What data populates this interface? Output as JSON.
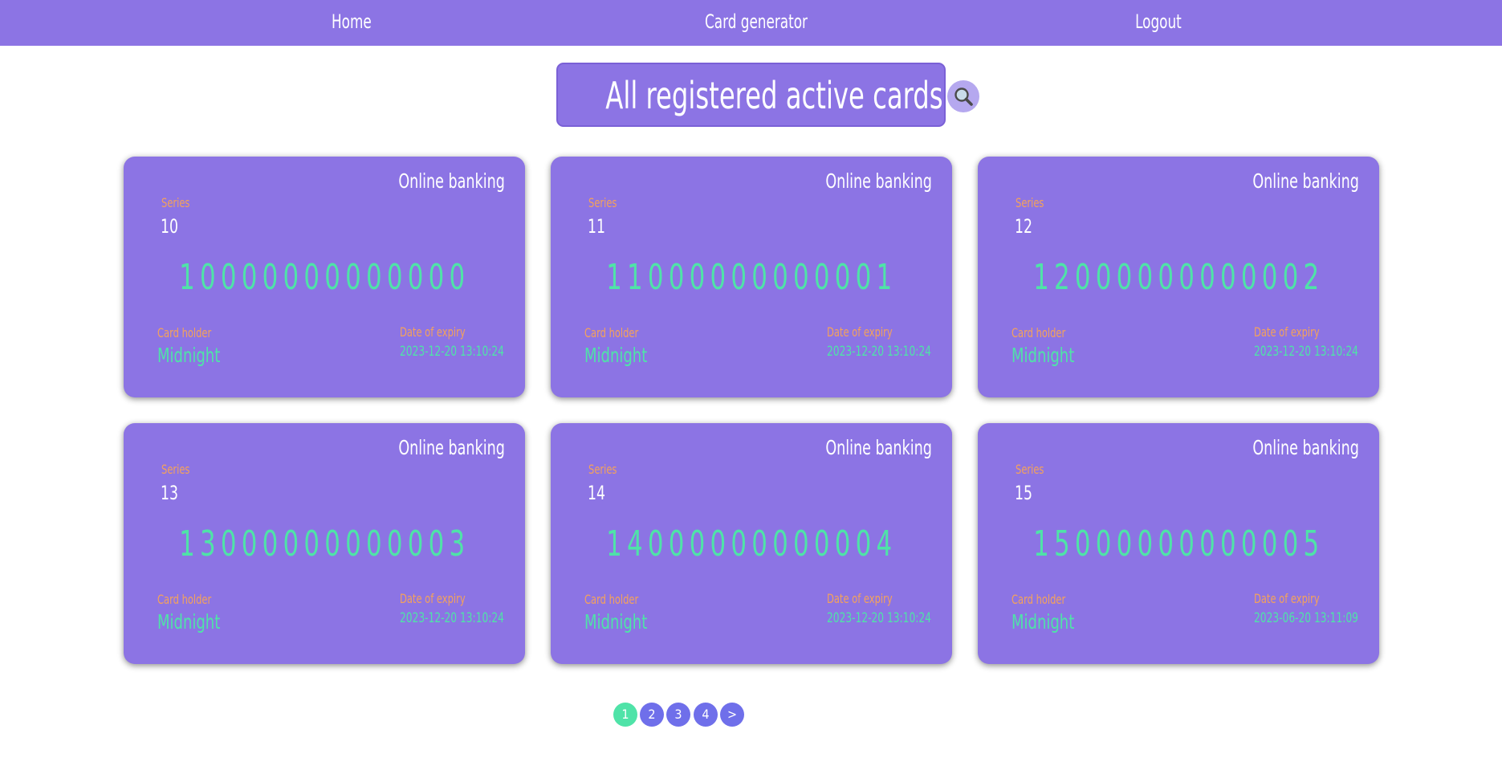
{
  "nav": {
    "home": "Home",
    "card_generator": "Card generator",
    "logout": "Logout"
  },
  "page_title": "All registered active cards",
  "search_icon": "magnifier-icon",
  "colors": {
    "primary": "#8c74e4",
    "accent_green": "#4fe3a8",
    "label_orange": "#f4a25b",
    "pagination": "#6f6fea"
  },
  "cards": [
    {
      "type": "Online banking",
      "series_label": "Series",
      "series": "10",
      "number": "10000000000000",
      "holder_label": "Card holder",
      "holder": "Midnight",
      "expiry_label": "Date of expiry",
      "expiry": "2023-12-20 13:10:24"
    },
    {
      "type": "Online banking",
      "series_label": "Series",
      "series": "11",
      "number": "11000000000001",
      "holder_label": "Card holder",
      "holder": "Midnight",
      "expiry_label": "Date of expiry",
      "expiry": "2023-12-20 13:10:24"
    },
    {
      "type": "Online banking",
      "series_label": "Series",
      "series": "12",
      "number": "12000000000002",
      "holder_label": "Card holder",
      "holder": "Midnight",
      "expiry_label": "Date of expiry",
      "expiry": "2023-12-20 13:10:24"
    },
    {
      "type": "Online banking",
      "series_label": "Series",
      "series": "13",
      "number": "13000000000003",
      "holder_label": "Card holder",
      "holder": "Midnight",
      "expiry_label": "Date of expiry",
      "expiry": "2023-12-20 13:10:24"
    },
    {
      "type": "Online banking",
      "series_label": "Series",
      "series": "14",
      "number": "14000000000004",
      "holder_label": "Card holder",
      "holder": "Midnight",
      "expiry_label": "Date of expiry",
      "expiry": "2023-12-20 13:10:24"
    },
    {
      "type": "Online banking",
      "series_label": "Series",
      "series": "15",
      "number": "15000000000005",
      "holder_label": "Card holder",
      "holder": "Midnight",
      "expiry_label": "Date of expiry",
      "expiry": "2023-06-20 13:11:09"
    }
  ],
  "pagination": {
    "pages": [
      "1",
      "2",
      "3",
      "4"
    ],
    "current": "1",
    "next": ">"
  }
}
